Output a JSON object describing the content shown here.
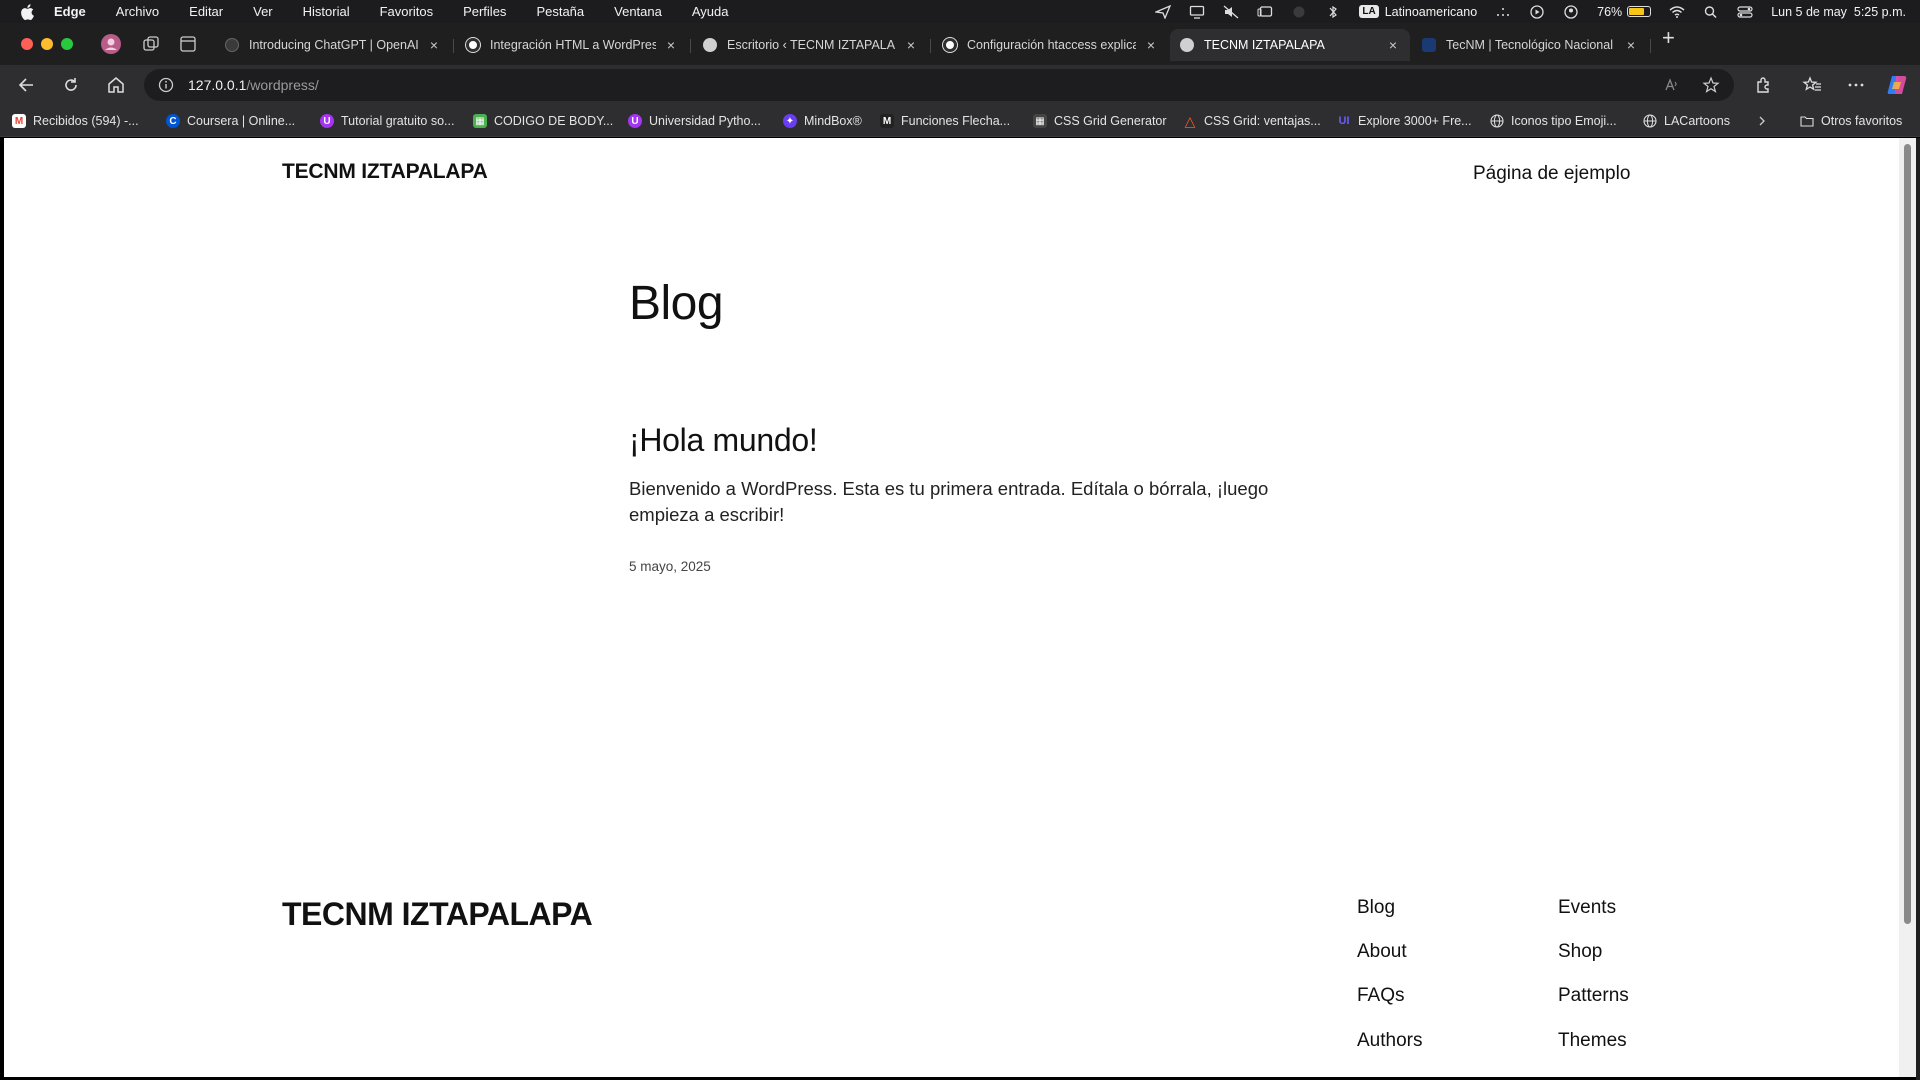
{
  "menubar": {
    "app_name": "Edge",
    "items": [
      "Archivo",
      "Editar",
      "Ver",
      "Historial",
      "Favoritos",
      "Perfiles",
      "Pestaña",
      "Ventana",
      "Ayuda"
    ],
    "input_source_badge": "LA",
    "input_source": "Latinoamericano",
    "battery_percent": "76%",
    "battery_level": 0.76,
    "datetime": "Lun 5 de may  5:25 p.m."
  },
  "tabs": [
    {
      "title": "Introducing ChatGPT | OpenAI",
      "icon": "openai-icon",
      "active": false
    },
    {
      "title": "Integración HTML a WordPress",
      "icon": "chatgpt-icon",
      "active": false
    },
    {
      "title": "Escritorio ‹ TECNM IZTAPALAPA",
      "icon": "wordpress-icon",
      "active": false
    },
    {
      "title": "Configuración htaccess explica",
      "icon": "chatgpt-icon",
      "active": false
    },
    {
      "title": "TECNM IZTAPALAPA",
      "icon": "wordpress-icon",
      "active": true
    },
    {
      "title": "TecNM | Tecnológico Nacional d",
      "icon": "tecnm-icon",
      "active": false
    }
  ],
  "address": {
    "host": "127.0.0.1",
    "path": "/wordpress/"
  },
  "bookmarks": [
    {
      "label": "Recibidos (594) -...",
      "icon": "gmail-icon",
      "color": "#ea4335",
      "glyph": "M"
    },
    {
      "label": "Coursera | Online...",
      "icon": "coursera-icon",
      "color": "#0056d2",
      "glyph": "C"
    },
    {
      "label": "Tutorial gratuito so...",
      "icon": "ud-icon",
      "color": "#a435f0",
      "glyph": "U"
    },
    {
      "label": "CODIGO DE BODY...",
      "icon": "book-icon",
      "color": "#4caf50",
      "glyph": "▦"
    },
    {
      "label": "Universidad Pytho...",
      "icon": "ud-icon",
      "color": "#a435f0",
      "glyph": "U"
    },
    {
      "label": "MindBox®",
      "icon": "mindbox-icon",
      "color": "#6a3df0",
      "glyph": "✦"
    },
    {
      "label": "Funciones Flecha...",
      "icon": "medium-icon",
      "color": "#222222",
      "glyph": "M"
    },
    {
      "label": "CSS Grid Generator",
      "icon": "grid-icon",
      "color": "#444444",
      "glyph": "▦"
    },
    {
      "label": "CSS Grid: ventajas...",
      "icon": "triangle-icon",
      "color": "#ff5722",
      "glyph": "△"
    },
    {
      "label": "Explore 3000+ Fre...",
      "icon": "ui-icon",
      "color": "#6a5cff",
      "glyph": "UI"
    },
    {
      "label": "Iconos tipo Emoji...",
      "icon": "globe-icon",
      "color": "#555555",
      "glyph": "◍"
    },
    {
      "label": "LACartoons",
      "icon": "globe-icon",
      "color": "#555555",
      "glyph": "◍"
    }
  ],
  "bookmarks_other": "Otros favoritos",
  "site": {
    "title": "TECNM IZTAPALAPA",
    "nav_link": "Página de ejemplo",
    "page_heading": "Blog",
    "post": {
      "title": "¡Hola mundo!",
      "excerpt": "Bienvenido a WordPress. Esta es tu primera entrada. Edítala o bórrala, ¡luego empieza a escribir!",
      "date": "5 mayo, 2025"
    },
    "footer": {
      "title": "TECNM IZTAPALAPA",
      "col1": [
        "Blog",
        "About",
        "FAQs",
        "Authors"
      ],
      "col2": [
        "Events",
        "Shop",
        "Patterns",
        "Themes"
      ]
    }
  }
}
